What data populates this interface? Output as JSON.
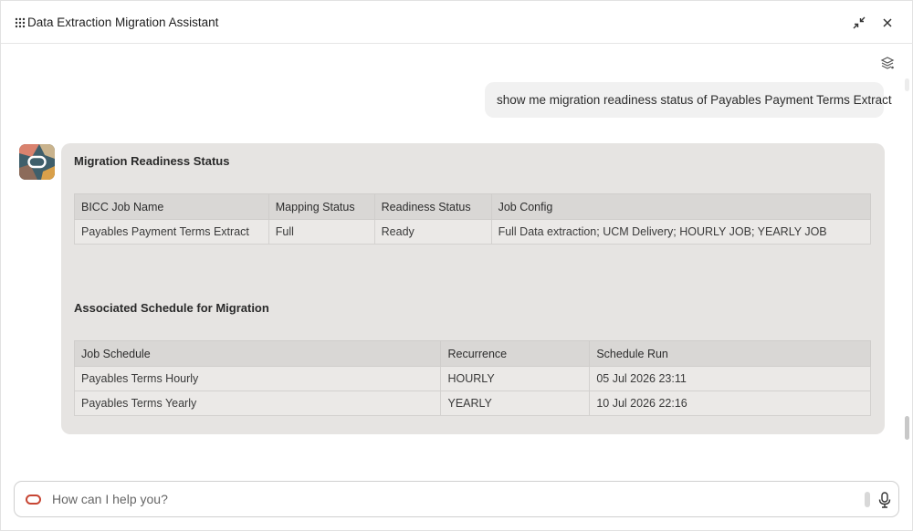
{
  "window": {
    "title": "Data Extraction Migration Assistant"
  },
  "conversation": {
    "user_message": "show me migration readiness status of Payables Payment Terms Extract",
    "response": {
      "readiness": {
        "title": "Migration Readiness Status",
        "columns": [
          "BICC Job Name",
          "Mapping Status",
          "Readiness Status",
          "Job Config"
        ],
        "rows": [
          [
            "Payables Payment Terms Extract",
            "Full",
            "Ready",
            "Full Data extraction; UCM Delivery; HOURLY JOB; YEARLY JOB"
          ]
        ]
      },
      "schedules": {
        "title": "Associated Schedule for Migration",
        "columns": [
          "Job Schedule",
          "Recurrence",
          "Schedule Run"
        ],
        "rows": [
          [
            "Payables Terms Hourly",
            "HOURLY",
            "05 Jul 2026 23:11"
          ],
          [
            "Payables Terms Yearly",
            "YEARLY",
            "10 Jul 2026 22:16"
          ]
        ]
      }
    }
  },
  "input": {
    "placeholder": "How can I help you?",
    "value": ""
  },
  "colors": {
    "brand_red": "#c74634",
    "bubble_bg": "#e6e4e2",
    "user_bubble_bg": "#f1f1f1"
  },
  "icons": {
    "drag": "grip-dots-icon",
    "collapse": "collapse-arrows-icon",
    "close": "close-icon",
    "layers": "layers-icon",
    "mic": "microphone-icon",
    "logo": "oracle-logo-icon"
  }
}
